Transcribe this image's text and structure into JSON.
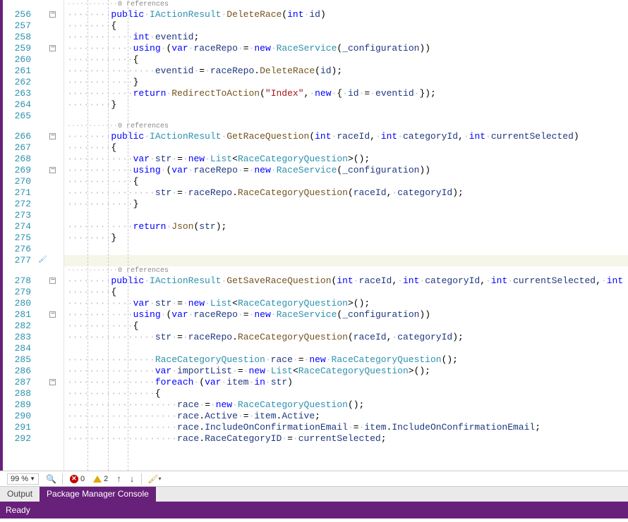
{
  "refs_label": "0 references",
  "lines": {
    "256": [
      [
        "dots",
        "········"
      ],
      [
        "kw",
        "public"
      ],
      [
        "dots",
        "·"
      ],
      [
        "type",
        "IActionResult"
      ],
      [
        "dots",
        "·"
      ],
      [
        "method",
        "DeleteRace"
      ],
      [
        "plain",
        "("
      ],
      [
        "kw",
        "int"
      ],
      [
        "dots",
        "·"
      ],
      [
        "var",
        "id"
      ],
      [
        "plain",
        ")"
      ]
    ],
    "257": [
      [
        "dots",
        "········"
      ],
      [
        "plain",
        "{"
      ]
    ],
    "258": [
      [
        "dots",
        "············"
      ],
      [
        "kw",
        "int"
      ],
      [
        "dots",
        "·"
      ],
      [
        "var",
        "eventid"
      ],
      [
        "plain",
        ";"
      ]
    ],
    "259": [
      [
        "dots",
        "············"
      ],
      [
        "kw",
        "using"
      ],
      [
        "dots",
        "·"
      ],
      [
        "plain",
        "("
      ],
      [
        "kw",
        "var"
      ],
      [
        "dots",
        "·"
      ],
      [
        "var",
        "raceRepo"
      ],
      [
        "dots",
        "·"
      ],
      [
        "plain",
        "="
      ],
      [
        "dots",
        "·"
      ],
      [
        "kw",
        "new"
      ],
      [
        "dots",
        "·"
      ],
      [
        "type",
        "RaceService"
      ],
      [
        "plain",
        "("
      ],
      [
        "var",
        "_configuration"
      ],
      [
        "plain",
        "))"
      ]
    ],
    "260": [
      [
        "dots",
        "············"
      ],
      [
        "plain",
        "{"
      ]
    ],
    "261": [
      [
        "dots",
        "················"
      ],
      [
        "var",
        "eventid"
      ],
      [
        "dots",
        "·"
      ],
      [
        "plain",
        "="
      ],
      [
        "dots",
        "·"
      ],
      [
        "var",
        "raceRepo"
      ],
      [
        "plain",
        "."
      ],
      [
        "method",
        "DeleteRace"
      ],
      [
        "plain",
        "("
      ],
      [
        "var",
        "id"
      ],
      [
        "plain",
        ");"
      ]
    ],
    "262": [
      [
        "dots",
        "············"
      ],
      [
        "plain",
        "}"
      ]
    ],
    "263": [
      [
        "dots",
        "············"
      ],
      [
        "kw",
        "return"
      ],
      [
        "dots",
        "·"
      ],
      [
        "method",
        "RedirectToAction"
      ],
      [
        "plain",
        "("
      ],
      [
        "str",
        "\"Index\""
      ],
      [
        "plain",
        ","
      ],
      [
        "dots",
        "·"
      ],
      [
        "kw",
        "new"
      ],
      [
        "dots",
        "·"
      ],
      [
        "plain",
        "{"
      ],
      [
        "dots",
        "·"
      ],
      [
        "var",
        "id"
      ],
      [
        "dots",
        "·"
      ],
      [
        "plain",
        "="
      ],
      [
        "dots",
        "·"
      ],
      [
        "var",
        "eventid"
      ],
      [
        "dots",
        "·"
      ],
      [
        "plain",
        "});"
      ]
    ],
    "264": [
      [
        "dots",
        "········"
      ],
      [
        "plain",
        "}"
      ]
    ],
    "265": [
      [
        "plain",
        ""
      ]
    ],
    "266": [
      [
        "dots",
        "········"
      ],
      [
        "kw",
        "public"
      ],
      [
        "dots",
        "·"
      ],
      [
        "type",
        "IActionResult"
      ],
      [
        "dots",
        "·"
      ],
      [
        "method",
        "GetRaceQuestion"
      ],
      [
        "plain",
        "("
      ],
      [
        "kw",
        "int"
      ],
      [
        "dots",
        "·"
      ],
      [
        "var",
        "raceId"
      ],
      [
        "plain",
        ","
      ],
      [
        "dots",
        "·"
      ],
      [
        "kw",
        "int"
      ],
      [
        "dots",
        "·"
      ],
      [
        "var",
        "categoryId"
      ],
      [
        "plain",
        ","
      ],
      [
        "dots",
        "·"
      ],
      [
        "kw",
        "int"
      ],
      [
        "dots",
        "·"
      ],
      [
        "var",
        "currentSelected"
      ],
      [
        "plain",
        ")"
      ]
    ],
    "267": [
      [
        "dots",
        "········"
      ],
      [
        "plain",
        "{"
      ]
    ],
    "268": [
      [
        "dots",
        "············"
      ],
      [
        "kw",
        "var"
      ],
      [
        "dots",
        "·"
      ],
      [
        "var",
        "str"
      ],
      [
        "dots",
        "·"
      ],
      [
        "plain",
        "="
      ],
      [
        "dots",
        "·"
      ],
      [
        "kw",
        "new"
      ],
      [
        "dots",
        "·"
      ],
      [
        "type",
        "List"
      ],
      [
        "plain",
        "<"
      ],
      [
        "type",
        "RaceCategoryQuestion"
      ],
      [
        "plain",
        ">();"
      ]
    ],
    "269": [
      [
        "dots",
        "············"
      ],
      [
        "kw",
        "using"
      ],
      [
        "dots",
        "·"
      ],
      [
        "plain",
        "("
      ],
      [
        "kw",
        "var"
      ],
      [
        "dots",
        "·"
      ],
      [
        "var",
        "raceRepo"
      ],
      [
        "dots",
        "·"
      ],
      [
        "plain",
        "="
      ],
      [
        "dots",
        "·"
      ],
      [
        "kw",
        "new"
      ],
      [
        "dots",
        "·"
      ],
      [
        "type",
        "RaceService"
      ],
      [
        "plain",
        "("
      ],
      [
        "var",
        "_configuration"
      ],
      [
        "plain",
        "))"
      ]
    ],
    "270": [
      [
        "dots",
        "············"
      ],
      [
        "plain",
        "{"
      ]
    ],
    "271": [
      [
        "dots",
        "················"
      ],
      [
        "var",
        "str"
      ],
      [
        "dots",
        "·"
      ],
      [
        "plain",
        "="
      ],
      [
        "dots",
        "·"
      ],
      [
        "var",
        "raceRepo"
      ],
      [
        "plain",
        "."
      ],
      [
        "method",
        "RaceCategoryQuestion"
      ],
      [
        "plain",
        "("
      ],
      [
        "var",
        "raceId"
      ],
      [
        "plain",
        ","
      ],
      [
        "dots",
        "·"
      ],
      [
        "var",
        "categoryId"
      ],
      [
        "plain",
        ");"
      ]
    ],
    "272": [
      [
        "dots",
        "············"
      ],
      [
        "plain",
        "}"
      ]
    ],
    "273": [
      [
        "plain",
        ""
      ]
    ],
    "274": [
      [
        "dots",
        "············"
      ],
      [
        "kw",
        "return"
      ],
      [
        "dots",
        "·"
      ],
      [
        "method",
        "Json"
      ],
      [
        "plain",
        "("
      ],
      [
        "var",
        "str"
      ],
      [
        "plain",
        ");"
      ]
    ],
    "275": [
      [
        "dots",
        "········"
      ],
      [
        "plain",
        "}"
      ]
    ],
    "276": [
      [
        "plain",
        ""
      ]
    ],
    "277": [
      [
        "plain",
        ""
      ]
    ],
    "278": [
      [
        "dots",
        "········"
      ],
      [
        "kw",
        "public"
      ],
      [
        "dots",
        "·"
      ],
      [
        "type",
        "IActionResult"
      ],
      [
        "dots",
        "·"
      ],
      [
        "method",
        "GetSaveRaceQuestion"
      ],
      [
        "plain",
        "("
      ],
      [
        "kw",
        "int"
      ],
      [
        "dots",
        "·"
      ],
      [
        "var",
        "raceId"
      ],
      [
        "plain",
        ","
      ],
      [
        "dots",
        "·"
      ],
      [
        "kw",
        "int"
      ],
      [
        "dots",
        "·"
      ],
      [
        "var",
        "categoryId"
      ],
      [
        "plain",
        ","
      ],
      [
        "dots",
        "·"
      ],
      [
        "kw",
        "int"
      ],
      [
        "dots",
        "·"
      ],
      [
        "var",
        "currentSelected"
      ],
      [
        "plain",
        ","
      ],
      [
        "dots",
        "·"
      ],
      [
        "kw",
        "int"
      ]
    ],
    "279": [
      [
        "dots",
        "········"
      ],
      [
        "plain",
        "{"
      ]
    ],
    "280": [
      [
        "dots",
        "············"
      ],
      [
        "kw",
        "var"
      ],
      [
        "dots",
        "·"
      ],
      [
        "var",
        "str"
      ],
      [
        "dots",
        "·"
      ],
      [
        "plain",
        "="
      ],
      [
        "dots",
        "·"
      ],
      [
        "kw",
        "new"
      ],
      [
        "dots",
        "·"
      ],
      [
        "type",
        "List"
      ],
      [
        "plain",
        "<"
      ],
      [
        "type",
        "RaceCategoryQuestion"
      ],
      [
        "plain",
        ">();"
      ]
    ],
    "281": [
      [
        "dots",
        "············"
      ],
      [
        "kw",
        "using"
      ],
      [
        "dots",
        "·"
      ],
      [
        "plain",
        "("
      ],
      [
        "kw",
        "var"
      ],
      [
        "dots",
        "·"
      ],
      [
        "var",
        "raceRepo"
      ],
      [
        "dots",
        "·"
      ],
      [
        "plain",
        "="
      ],
      [
        "dots",
        "·"
      ],
      [
        "kw",
        "new"
      ],
      [
        "dots",
        "·"
      ],
      [
        "type",
        "RaceService"
      ],
      [
        "plain",
        "("
      ],
      [
        "var",
        "_configuration"
      ],
      [
        "plain",
        "))"
      ]
    ],
    "282": [
      [
        "dots",
        "············"
      ],
      [
        "plain",
        "{"
      ]
    ],
    "283": [
      [
        "dots",
        "················"
      ],
      [
        "var",
        "str"
      ],
      [
        "dots",
        "·"
      ],
      [
        "plain",
        "="
      ],
      [
        "dots",
        "·"
      ],
      [
        "var",
        "raceRepo"
      ],
      [
        "plain",
        "."
      ],
      [
        "method",
        "RaceCategoryQuestion"
      ],
      [
        "plain",
        "("
      ],
      [
        "var",
        "raceId"
      ],
      [
        "plain",
        ","
      ],
      [
        "dots",
        "·"
      ],
      [
        "var",
        "categoryId"
      ],
      [
        "plain",
        ");"
      ]
    ],
    "284": [
      [
        "plain",
        ""
      ]
    ],
    "285": [
      [
        "dots",
        "················"
      ],
      [
        "type",
        "RaceCategoryQuestion"
      ],
      [
        "dots",
        "·"
      ],
      [
        "var",
        "race"
      ],
      [
        "dots",
        "·"
      ],
      [
        "plain",
        "="
      ],
      [
        "dots",
        "·"
      ],
      [
        "kw",
        "new"
      ],
      [
        "dots",
        "·"
      ],
      [
        "type",
        "RaceCategoryQuestion"
      ],
      [
        "plain",
        "();"
      ]
    ],
    "286": [
      [
        "dots",
        "················"
      ],
      [
        "kw",
        "var"
      ],
      [
        "dots",
        "·"
      ],
      [
        "var",
        "importList"
      ],
      [
        "dots",
        "·"
      ],
      [
        "plain",
        "="
      ],
      [
        "dots",
        "·"
      ],
      [
        "kw",
        "new"
      ],
      [
        "dots",
        "·"
      ],
      [
        "type",
        "List"
      ],
      [
        "plain",
        "<"
      ],
      [
        "type",
        "RaceCategoryQuestion"
      ],
      [
        "plain",
        ">();"
      ]
    ],
    "287": [
      [
        "dots",
        "················"
      ],
      [
        "kw",
        "foreach"
      ],
      [
        "dots",
        "·"
      ],
      [
        "plain",
        "("
      ],
      [
        "kw",
        "var"
      ],
      [
        "dots",
        "·"
      ],
      [
        "var",
        "item"
      ],
      [
        "dots",
        "·"
      ],
      [
        "kw",
        "in"
      ],
      [
        "dots",
        "·"
      ],
      [
        "var",
        "str"
      ],
      [
        "plain",
        ")"
      ]
    ],
    "288": [
      [
        "dots",
        "················"
      ],
      [
        "plain",
        "{"
      ]
    ],
    "289": [
      [
        "dots",
        "····················"
      ],
      [
        "var",
        "race"
      ],
      [
        "dots",
        "·"
      ],
      [
        "plain",
        "="
      ],
      [
        "dots",
        "·"
      ],
      [
        "kw",
        "new"
      ],
      [
        "dots",
        "·"
      ],
      [
        "type",
        "RaceCategoryQuestion"
      ],
      [
        "plain",
        "();"
      ]
    ],
    "290": [
      [
        "dots",
        "····················"
      ],
      [
        "var",
        "race"
      ],
      [
        "plain",
        "."
      ],
      [
        "var",
        "Active"
      ],
      [
        "dots",
        "·"
      ],
      [
        "plain",
        "="
      ],
      [
        "dots",
        "·"
      ],
      [
        "var",
        "item"
      ],
      [
        "plain",
        "."
      ],
      [
        "var",
        "Active"
      ],
      [
        "plain",
        ";"
      ]
    ],
    "291": [
      [
        "dots",
        "····················"
      ],
      [
        "var",
        "race"
      ],
      [
        "plain",
        "."
      ],
      [
        "var",
        "IncludeOnConfirmationEmail"
      ],
      [
        "dots",
        "·"
      ],
      [
        "plain",
        "="
      ],
      [
        "dots",
        "·"
      ],
      [
        "var",
        "item"
      ],
      [
        "plain",
        "."
      ],
      [
        "var",
        "IncludeOnConfirmationEmail"
      ],
      [
        "plain",
        ";"
      ]
    ],
    "292": [
      [
        "dots",
        "····················"
      ],
      [
        "var",
        "race"
      ],
      [
        "plain",
        "."
      ],
      [
        "var",
        "RaceCategoryID"
      ],
      [
        "dots",
        "·"
      ],
      [
        "plain",
        "="
      ],
      [
        "dots",
        "·"
      ],
      [
        "var",
        "currentSelected"
      ],
      [
        "plain",
        ";"
      ]
    ]
  },
  "status": {
    "zoom": "99 %",
    "errors": "0",
    "warnings": "2"
  },
  "tabs": {
    "output": "Output",
    "pmc": "Package Manager Console"
  },
  "bottom": {
    "ready": "Ready"
  }
}
